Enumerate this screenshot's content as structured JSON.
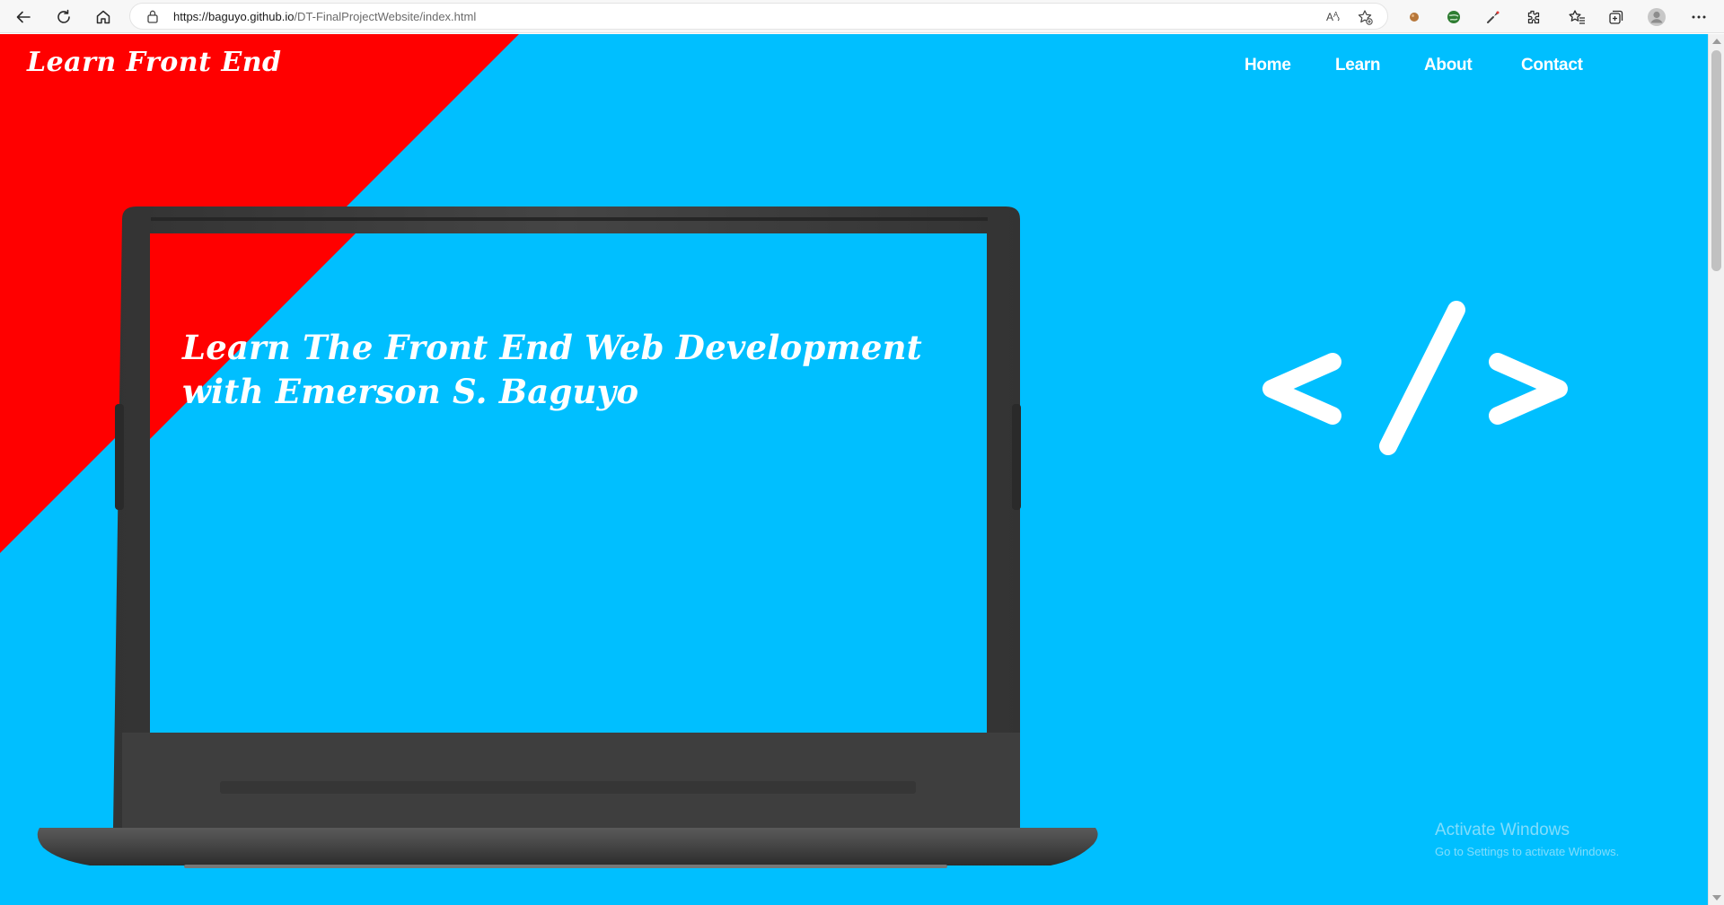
{
  "browser": {
    "url_host": "https://baguyo.github.io",
    "url_path": "/DT-FinalProjectWebsite/index.html",
    "icons": [
      "back-icon",
      "refresh-icon",
      "home-icon",
      "lock-icon",
      "read-aloud-icon",
      "add-favorite-icon",
      "extension-icon",
      "extensions-icon",
      "favorites-icon",
      "collections-icon",
      "profile-icon",
      "more-icon"
    ]
  },
  "site": {
    "logo": "Learn Front End",
    "nav": {
      "home": "Home",
      "learn": "Learn",
      "about": "About",
      "contact": "Contact"
    },
    "headline_line1": "Learn The Front End Web Development",
    "headline_line2": "with Emerson S. Baguyo",
    "code_symbol": "</>"
  },
  "os": {
    "watermark_title": "Activate Windows",
    "watermark_subtitle": "Go to Settings to activate Windows."
  },
  "colors": {
    "page_background": "#00bfff",
    "accent_triangle": "#ff0000",
    "text": "#ffffff",
    "laptop_body": "#3d3d3d"
  }
}
